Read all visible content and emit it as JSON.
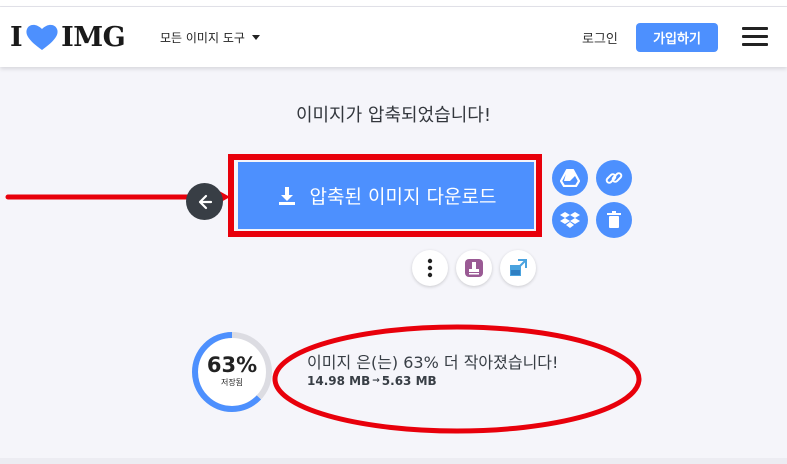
{
  "header": {
    "logo_left": "I",
    "logo_right": "IMG",
    "tools_menu_label": "모든 이미지 도구",
    "login_label": "로그인",
    "signup_label": "가입하기"
  },
  "main": {
    "title": "이미지가 압축되었습니다!",
    "download_label": "압축된 이미지 다운로드",
    "result_text": "이미지 은(는) 63% 더 작아졌습니다!",
    "original_size": "14.98 MB",
    "compressed_size": "5.63 MB",
    "size_arrow": "→"
  },
  "progress": {
    "percent_label": "63%",
    "saved_label": "저장됨",
    "value": 0.63
  },
  "colors": {
    "accent": "#4d90fe",
    "annotation_red": "#e8000b",
    "dark": "#383e45",
    "background": "#f5f5fa"
  },
  "icons": [
    "heart-logo-icon",
    "chevron-down-icon",
    "hamburger-menu-icon",
    "back-arrow-icon",
    "download-icon",
    "google-drive-icon",
    "link-icon",
    "dropbox-icon",
    "trash-icon",
    "more-options-icon",
    "stamp-icon",
    "resize-icon"
  ]
}
